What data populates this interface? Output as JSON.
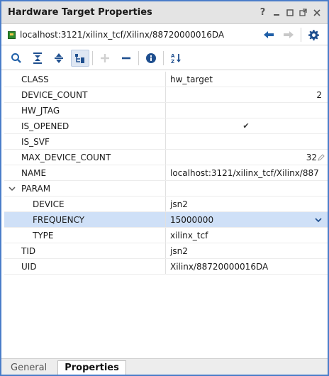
{
  "window": {
    "title": "Hardware Target Properties",
    "buttons": {
      "help": "?",
      "minimize": "–",
      "maximize": "☐",
      "float": "⧉",
      "close": "✕"
    }
  },
  "path": {
    "text": "localhost:3121/xilinx_tcf/Xilinx/88720000016DA",
    "icon": "hw-target-icon"
  },
  "toolbar": {
    "tools": [
      "search-icon",
      "collapse-all-icon",
      "expand-all-icon",
      "group-icon",
      "add-icon",
      "remove-icon",
      "info-icon",
      "sort-icon"
    ]
  },
  "properties": [
    {
      "name": "CLASS",
      "value": "hw_target"
    },
    {
      "name": "DEVICE_COUNT",
      "value": "2"
    },
    {
      "name": "HW_JTAG",
      "value": ""
    },
    {
      "name": "IS_OPENED",
      "value": "✔"
    },
    {
      "name": "IS_SVF",
      "value": ""
    },
    {
      "name": "MAX_DEVICE_COUNT",
      "value": "32"
    },
    {
      "name": "NAME",
      "value": "localhost:3121/xilinx_tcf/Xilinx/887"
    },
    {
      "name": "PARAM",
      "value": "",
      "expanded": true
    },
    {
      "name": "DEVICE",
      "value": "jsn2"
    },
    {
      "name": "FREQUENCY",
      "value": "15000000",
      "selected": true
    },
    {
      "name": "TYPE",
      "value": "xilinx_tcf"
    },
    {
      "name": "TID",
      "value": "jsn2"
    },
    {
      "name": "UID",
      "value": "Xilinx/88720000016DA"
    }
  ],
  "tabs": [
    {
      "label": "General",
      "active": false
    },
    {
      "label": "Properties",
      "active": true
    }
  ],
  "colors": {
    "border": "#4a7dc9",
    "selection": "#cfe0f7",
    "icon_blue": "#1f5fa8"
  }
}
